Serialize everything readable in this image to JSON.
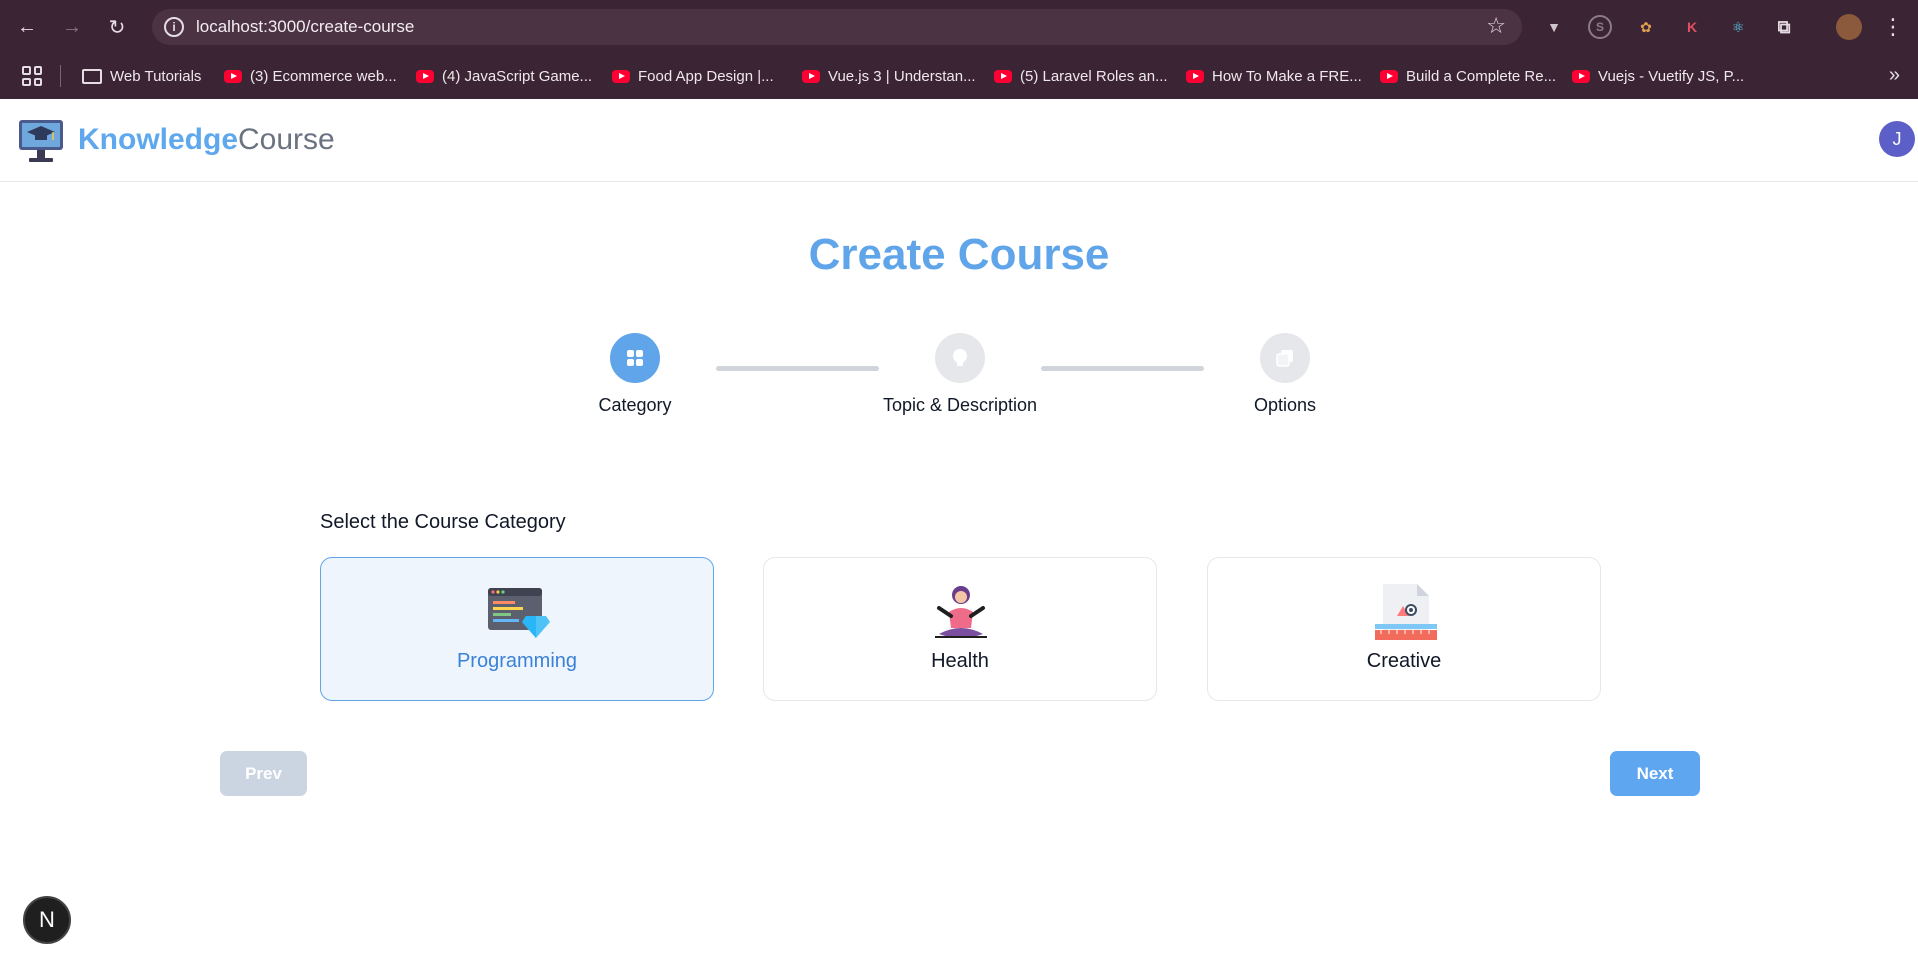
{
  "browser": {
    "url": "localhost:3000/create-course",
    "bookmarks": [
      "Web Tutorials",
      "(3) Ecommerce web...",
      "(4) JavaScript Game...",
      "Food App Design |...",
      "Vue.js 3 | Understan...",
      "(5) Laravel Roles an...",
      "How To Make a FRE...",
      "Build a Complete Re...",
      "Vuejs - Vuetify JS, P..."
    ]
  },
  "header": {
    "brand_bold": "Knowledge",
    "brand_light": "Course",
    "avatar_initial": "J"
  },
  "main": {
    "title": "Create Course",
    "steps": [
      {
        "label": "Category",
        "icon": "grid-icon",
        "active": true
      },
      {
        "label": "Topic & Description",
        "icon": "lightbulb-icon",
        "active": false
      },
      {
        "label": "Options",
        "icon": "copy-icon",
        "active": false
      }
    ],
    "section_label": "Select the Course Category",
    "categories": [
      {
        "label": "Programming",
        "icon": "code-window-icon",
        "selected": true
      },
      {
        "label": "Health",
        "icon": "meditation-icon",
        "selected": false
      },
      {
        "label": "Creative",
        "icon": "design-document-icon",
        "selected": false
      }
    ],
    "prev_label": "Prev",
    "next_label": "Next"
  },
  "dev_badge": "N",
  "colors": {
    "accent": "#60a5ea",
    "brand_dark": "#3b82d6",
    "disabled": "#cbd5e1"
  }
}
